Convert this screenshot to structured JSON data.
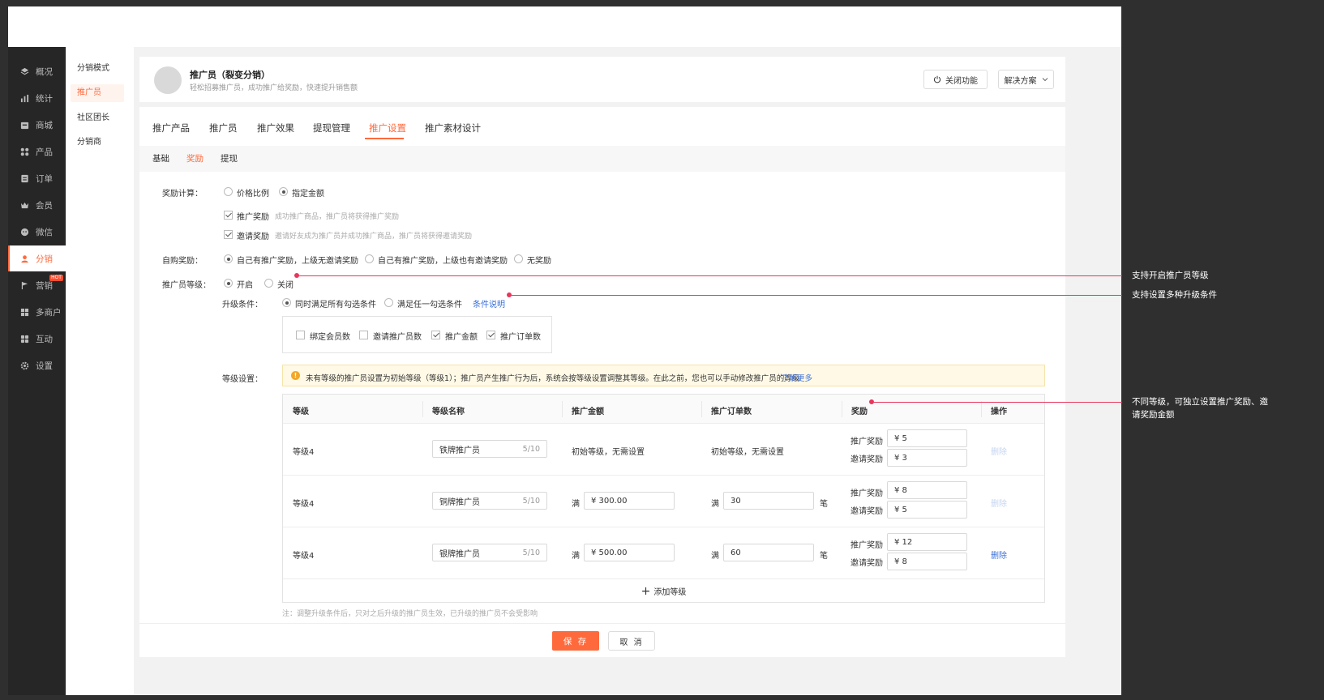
{
  "sidebar": {
    "items": [
      {
        "label": "概况",
        "icon": "layers-icon"
      },
      {
        "label": "统计",
        "icon": "chart-icon"
      },
      {
        "label": "商城",
        "icon": "shop-icon"
      },
      {
        "label": "产品",
        "icon": "grid-icon"
      },
      {
        "label": "订单",
        "icon": "order-icon"
      },
      {
        "label": "会员",
        "icon": "crown-icon"
      },
      {
        "label": "微信",
        "icon": "wechat-icon"
      },
      {
        "label": "分销",
        "icon": "user-icon"
      },
      {
        "label": "营销",
        "icon": "flag-icon"
      },
      {
        "label": "多商户",
        "icon": "store-icon"
      },
      {
        "label": "互动",
        "icon": "interact-icon"
      },
      {
        "label": "设置",
        "icon": "gear-icon"
      }
    ],
    "hot_badge": "HOT"
  },
  "subnav": {
    "items": [
      "分销模式",
      "推广员",
      "社区团长",
      "分销商"
    ]
  },
  "header": {
    "title": "推广员（裂变分销）",
    "subtitle": "轻松招募推广员，成功推广给奖励，快速提升销售额",
    "close_btn": "关闭功能",
    "solution_btn": "解决方案"
  },
  "tabs": [
    "推广产品",
    "推广员",
    "推广效果",
    "提现管理",
    "推广设置",
    "推广素材设计"
  ],
  "subtabs": [
    "基础",
    "奖励",
    "提现"
  ],
  "form": {
    "reward_calc_label": "奖励计算：",
    "reward_calc_options": [
      "价格比例",
      "指定金额"
    ],
    "promo_reward": {
      "label": "推广奖励",
      "desc": "成功推广商品，推广员将获得推广奖励"
    },
    "invite_reward": {
      "label": "邀请奖励",
      "desc": "邀请好友成为推广员并成功推广商品，推广员将获得邀请奖励"
    },
    "self_buy_label": "自购奖励：",
    "self_buy_options": [
      "自己有推广奖励，上级无邀请奖励",
      "自己有推广奖励，上级也有邀请奖励",
      "无奖励"
    ],
    "level_label": "推广员等级：",
    "level_options": [
      "开启",
      "关闭"
    ],
    "upgrade_label": "升级条件：",
    "upgrade_options": [
      "同时满足所有勾选条件",
      "满足任一勾选条件"
    ],
    "upgrade_link": "条件说明",
    "conditions": [
      {
        "label": "绑定会员数",
        "checked": false
      },
      {
        "label": "邀请推广员数",
        "checked": false
      },
      {
        "label": "推广金额",
        "checked": true
      },
      {
        "label": "推广订单数",
        "checked": true
      }
    ],
    "grade_label": "等级设置：",
    "alert_text": "未有等级的推广员设置为初始等级（等级1）；推广员产生推广行为后，系统会按等级设置调整其等级。在此之前，您也可以手动修改推广员的等级",
    "alert_link": "了解更多",
    "note": "注：调整升级条件后，只对之后升级的推广员生效，已升级的推广员不会受影响"
  },
  "table": {
    "headers": [
      "等级",
      "等级名称",
      "推广金额",
      "推广订单数",
      "奖励",
      "操作"
    ],
    "rows": [
      {
        "level": "等级4",
        "name": "铁牌推广员",
        "name_count": "5/10",
        "amount_text": "初始等级，无需设置",
        "orders_text": "初始等级，无需设置",
        "amount": "",
        "orders": "",
        "promo": "¥  5",
        "invite": "¥  3",
        "delete": "删除",
        "delete_enabled": false
      },
      {
        "level": "等级4",
        "name": "铜牌推广员",
        "name_count": "5/10",
        "amount_text": "",
        "orders_text": "",
        "amount": "¥   300.00",
        "orders": "30",
        "promo": "¥  8",
        "invite": "¥  5",
        "delete": "删除",
        "delete_enabled": false
      },
      {
        "level": "等级4",
        "name": "银牌推广员",
        "name_count": "5/10",
        "amount_text": "",
        "orders_text": "",
        "amount": "¥   500.00",
        "orders": "60",
        "promo": "¥  12",
        "invite": "¥  8",
        "delete": "删除",
        "delete_enabled": true
      }
    ],
    "full_prefix": "满",
    "orders_unit": "笔",
    "promo_label": "推广奖励",
    "invite_label": "邀请奖励",
    "add_level": "添加等级"
  },
  "footer": {
    "save": "保 存",
    "cancel": "取 消"
  },
  "annotations": [
    "支持开启推广员等级",
    "支持设置多种升级条件",
    "不同等级，可独立设置推广奖励、邀请奖励金额"
  ],
  "colors": {
    "accent": "#ff6a3d",
    "annotation": "#e8365d",
    "link": "#3a6fd8"
  }
}
